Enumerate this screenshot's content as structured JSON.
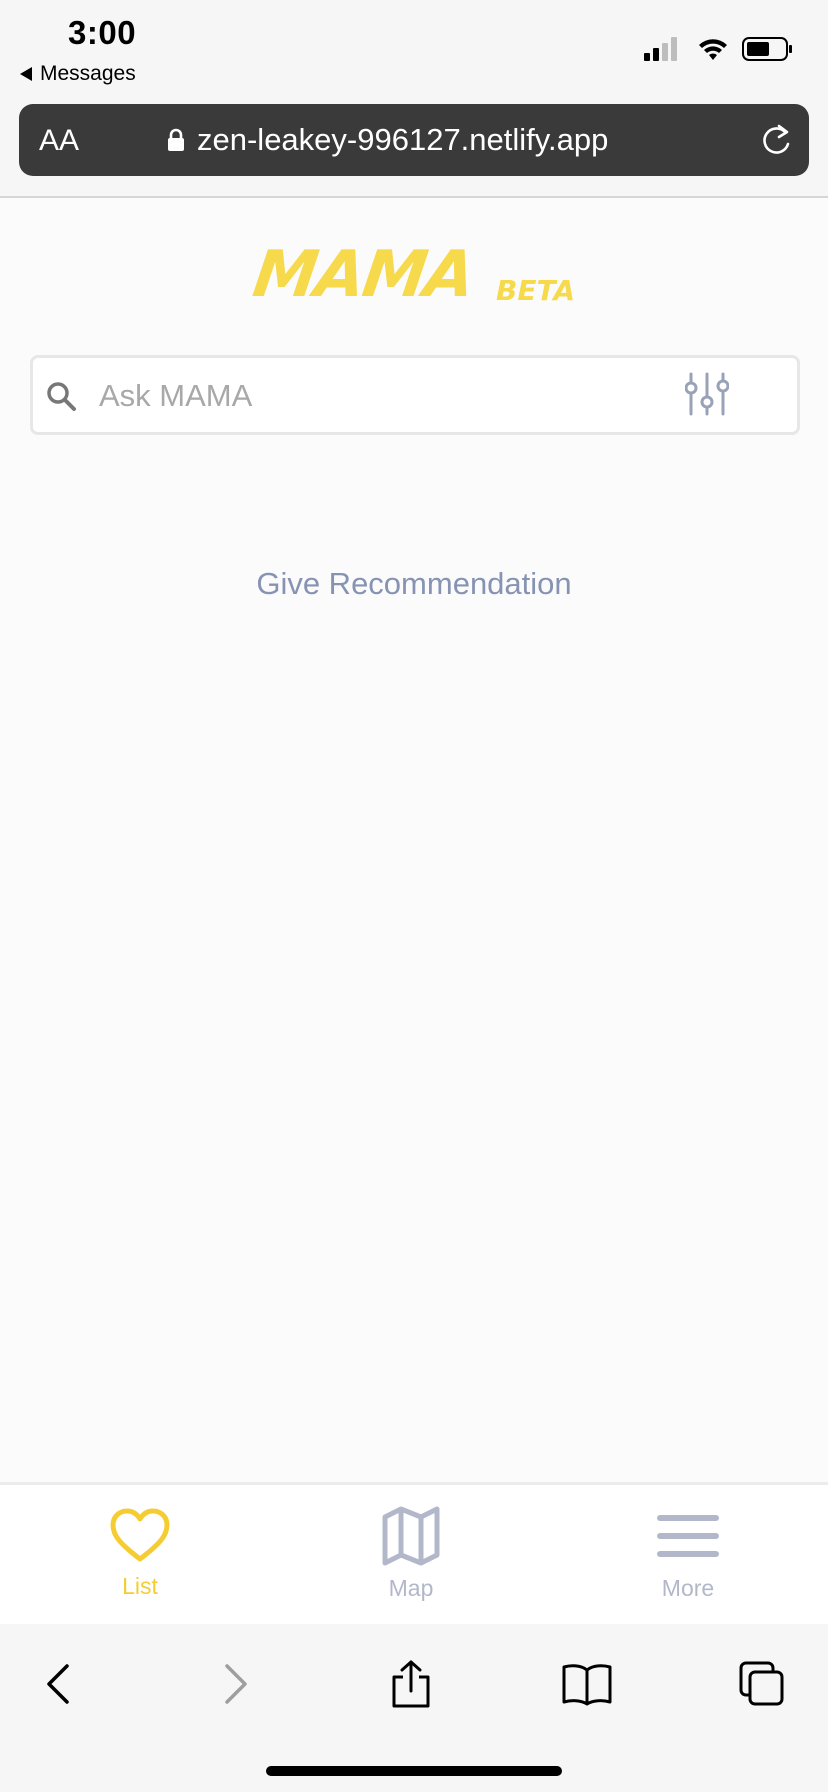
{
  "status": {
    "time": "3:00",
    "back_app": "Messages"
  },
  "browser": {
    "text_size_label": "AA",
    "url": "zen-leakey-996127.netlify.app"
  },
  "logo": {
    "name": "MAMA",
    "badge": "BETA"
  },
  "search": {
    "placeholder": "Ask MAMA",
    "value": ""
  },
  "main": {
    "give_recommendation": "Give Recommendation"
  },
  "tabs": [
    {
      "label": "List",
      "icon": "heart-icon",
      "active": true
    },
    {
      "label": "Map",
      "icon": "map-icon",
      "active": false
    },
    {
      "label": "More",
      "icon": "menu-icon",
      "active": false
    }
  ],
  "colors": {
    "brand_yellow": "#f7d94c",
    "tab_inactive": "#b2b8c9",
    "link": "#8793b3",
    "url_bar": "#3a3a3a"
  }
}
